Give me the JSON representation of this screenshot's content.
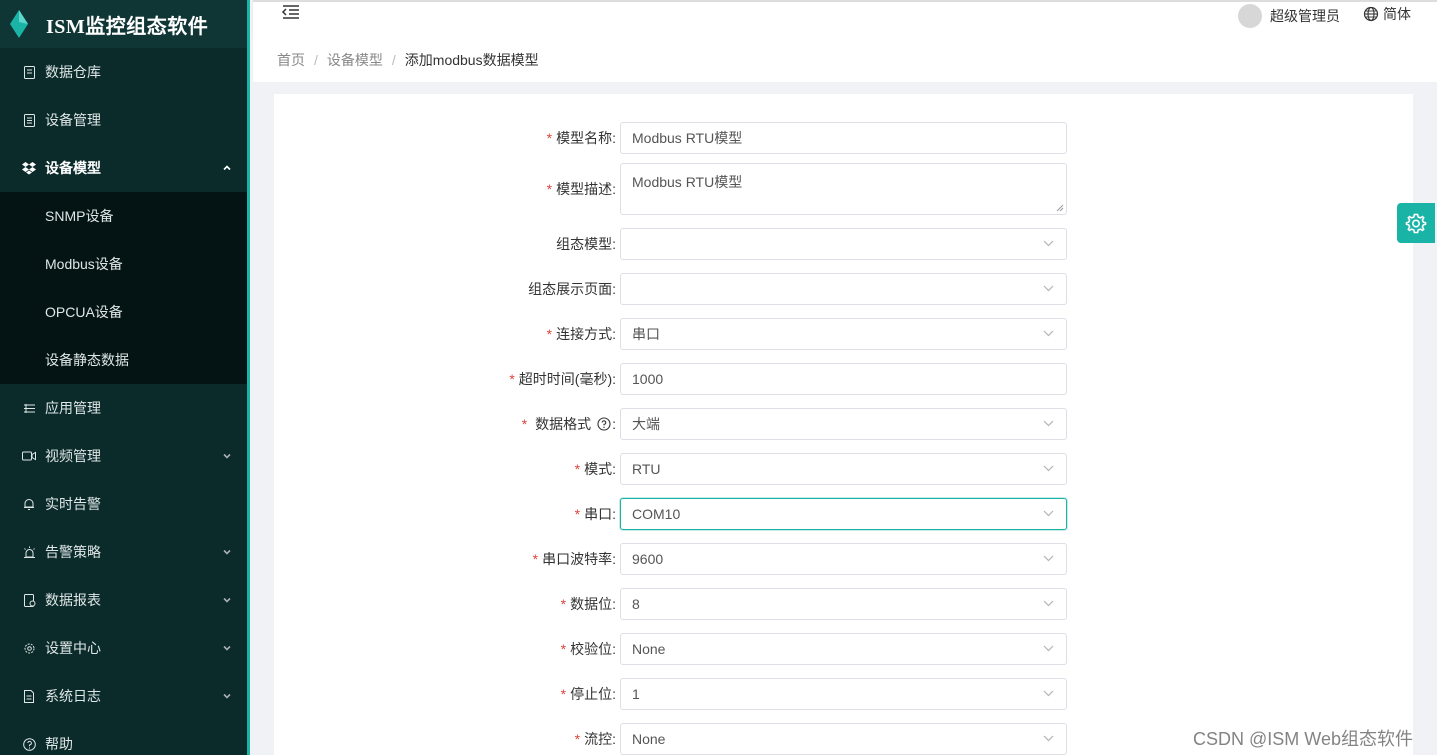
{
  "app": {
    "title": "ISM监控组态软件"
  },
  "sidebar": {
    "items": [
      {
        "label": "数据仓库"
      },
      {
        "label": "设备管理"
      },
      {
        "label": "设备模型"
      },
      {
        "label": "SNMP设备"
      },
      {
        "label": "Modbus设备"
      },
      {
        "label": "OPCUA设备"
      },
      {
        "label": "设备静态数据"
      },
      {
        "label": "应用管理"
      },
      {
        "label": "视频管理"
      },
      {
        "label": "实时告警"
      },
      {
        "label": "告警策略"
      },
      {
        "label": "数据报表"
      },
      {
        "label": "设置中心"
      },
      {
        "label": "系统日志"
      },
      {
        "label": "帮助"
      }
    ]
  },
  "header": {
    "user_name": "超级管理员",
    "language": "简体"
  },
  "breadcrumb": {
    "home": "首页",
    "level2": "设备模型",
    "current": "添加modbus数据模型"
  },
  "form": {
    "model_name": {
      "label": "模型名称:",
      "value": "Modbus RTU模型"
    },
    "model_desc": {
      "label": "模型描述:",
      "value": "Modbus RTU模型"
    },
    "scada_model": {
      "label": "组态模型:",
      "value": ""
    },
    "scada_page": {
      "label": "组态展示页面:",
      "value": ""
    },
    "connection": {
      "label": "连接方式:",
      "value": "串口"
    },
    "timeout": {
      "label": "超时时间(毫秒):",
      "value": "1000"
    },
    "data_format": {
      "label": "数据格式",
      "label_suffix": ":",
      "value": "大端"
    },
    "mode": {
      "label": "模式:",
      "value": "RTU"
    },
    "serial_port": {
      "label": "串口:",
      "value": "COM10"
    },
    "baud_rate": {
      "label": "串口波特率:",
      "value": "9600"
    },
    "data_bits": {
      "label": "数据位:",
      "value": "8"
    },
    "parity": {
      "label": "校验位:",
      "value": "None"
    },
    "stop_bits": {
      "label": "停止位:",
      "value": "1"
    },
    "flow_control": {
      "label": "流控:",
      "value": "None"
    }
  },
  "watermark": "CSDN @ISM Web组态软件",
  "colors": {
    "sidebar_bg": "#0b2a2a",
    "accent": "#19b4a6",
    "required": "#e0443b"
  }
}
